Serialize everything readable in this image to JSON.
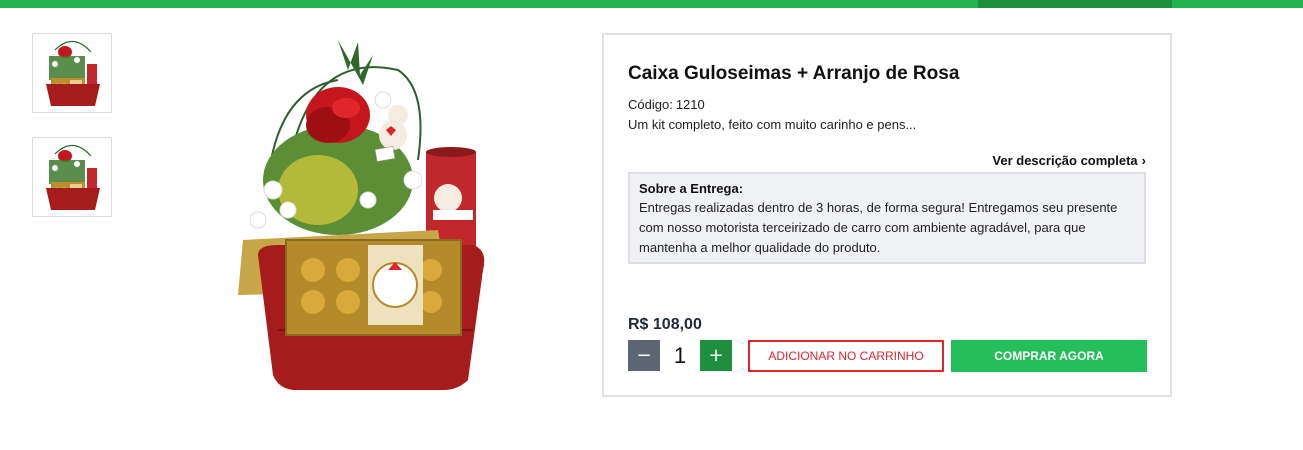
{
  "colors": {
    "brand_green": "#22b14c",
    "buy_button": "#24be5a",
    "cart_button_border": "#e0262d",
    "qty_minus": "#5d6673",
    "qty_plus": "#1e8f3e"
  },
  "gallery": {
    "thumbnails": [
      {
        "name": "thumbnail-1",
        "depicts": "gift-basket-photo"
      },
      {
        "name": "thumbnail-2",
        "depicts": "gift-basket-photo"
      }
    ],
    "main_image": {
      "depicts": "gift-basket-photo"
    }
  },
  "product": {
    "title": "Caixa Guloseimas + Arranjo de Rosa",
    "code_label": "Código:",
    "code_value": "1210",
    "summary": "Um kit completo, feito com muito carinho e pens...",
    "see_more_label": "Ver descrição completa",
    "see_more_icon": "chevron-right-icon",
    "delivery_title": "Sobre a Entrega:",
    "delivery_text": "Entregas realizadas dentro de 3 horas, de forma segura! Entregamos seu presente com nosso motorista terceirizado de carro com ambiente agradável, para que mantenha a melhor qualidade do produto.",
    "price": "R$ 108,00"
  },
  "purchase": {
    "quantity": "1",
    "minus_icon": "minus-icon",
    "plus_icon": "plus-icon",
    "add_to_cart_label": "ADICIONAR NO CARRINHO",
    "buy_now_label": "COMPRAR AGORA"
  }
}
